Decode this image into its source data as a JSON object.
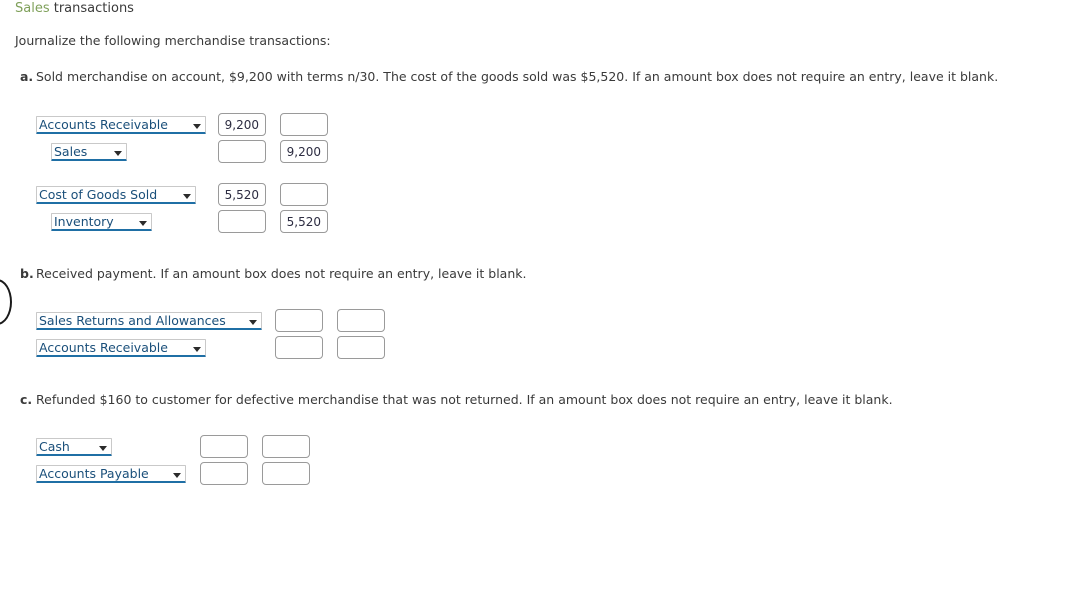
{
  "header": {
    "title_accent": "Sales",
    "title_rest": " transactions",
    "accent_color": "#7fa05a"
  },
  "instruction": "Journalize the following merchandise transactions:",
  "style": {
    "select_text_color": "#1a4f7a",
    "select_underline_color": "#1f6fa5",
    "amount_border_color": "#9a9a9a",
    "body_text_color": "#3a3a3a"
  },
  "requirements": [
    {
      "letter": "a.",
      "text": "Sold merchandise on account, $9,200 with terms n/30. The cost of the goods sold was $5,520. If an amount box does not require an entry, leave it blank.",
      "entries": [
        {
          "account": "Accounts Receivable",
          "indented": false,
          "select_width": 170,
          "debit": "9,200",
          "credit": ""
        },
        {
          "account": "Sales",
          "indented": true,
          "select_width": 76,
          "debit": "",
          "credit": "9,200"
        },
        {
          "account": "Cost of Goods Sold",
          "indented": false,
          "select_width": 160,
          "debit": "5,520",
          "credit": ""
        },
        {
          "account": "Inventory",
          "indented": true,
          "select_width": 101,
          "debit": "",
          "credit": "5,520"
        }
      ]
    },
    {
      "letter": "b.",
      "text": "Received payment. If an amount box does not require an entry, leave it blank.",
      "entries": [
        {
          "account": "Sales Returns and Allowances",
          "indented": false,
          "select_width": 226,
          "debit": "",
          "credit": ""
        },
        {
          "account": "Accounts Receivable",
          "indented": false,
          "select_width": 170,
          "debit": "",
          "credit": ""
        }
      ]
    },
    {
      "letter": "c.",
      "text": "Refunded $160 to customer for defective merchandise that was not returned. If an amount box does not require an entry, leave it blank.",
      "entries": [
        {
          "account": "Cash",
          "indented": false,
          "select_width": 76,
          "debit": "",
          "credit": ""
        },
        {
          "account": "Accounts Payable",
          "indented": false,
          "select_width": 150,
          "debit": "",
          "credit": ""
        }
      ]
    }
  ],
  "amount_columns": {
    "debit_label": "debit-amount",
    "credit_label": "credit-amount"
  }
}
